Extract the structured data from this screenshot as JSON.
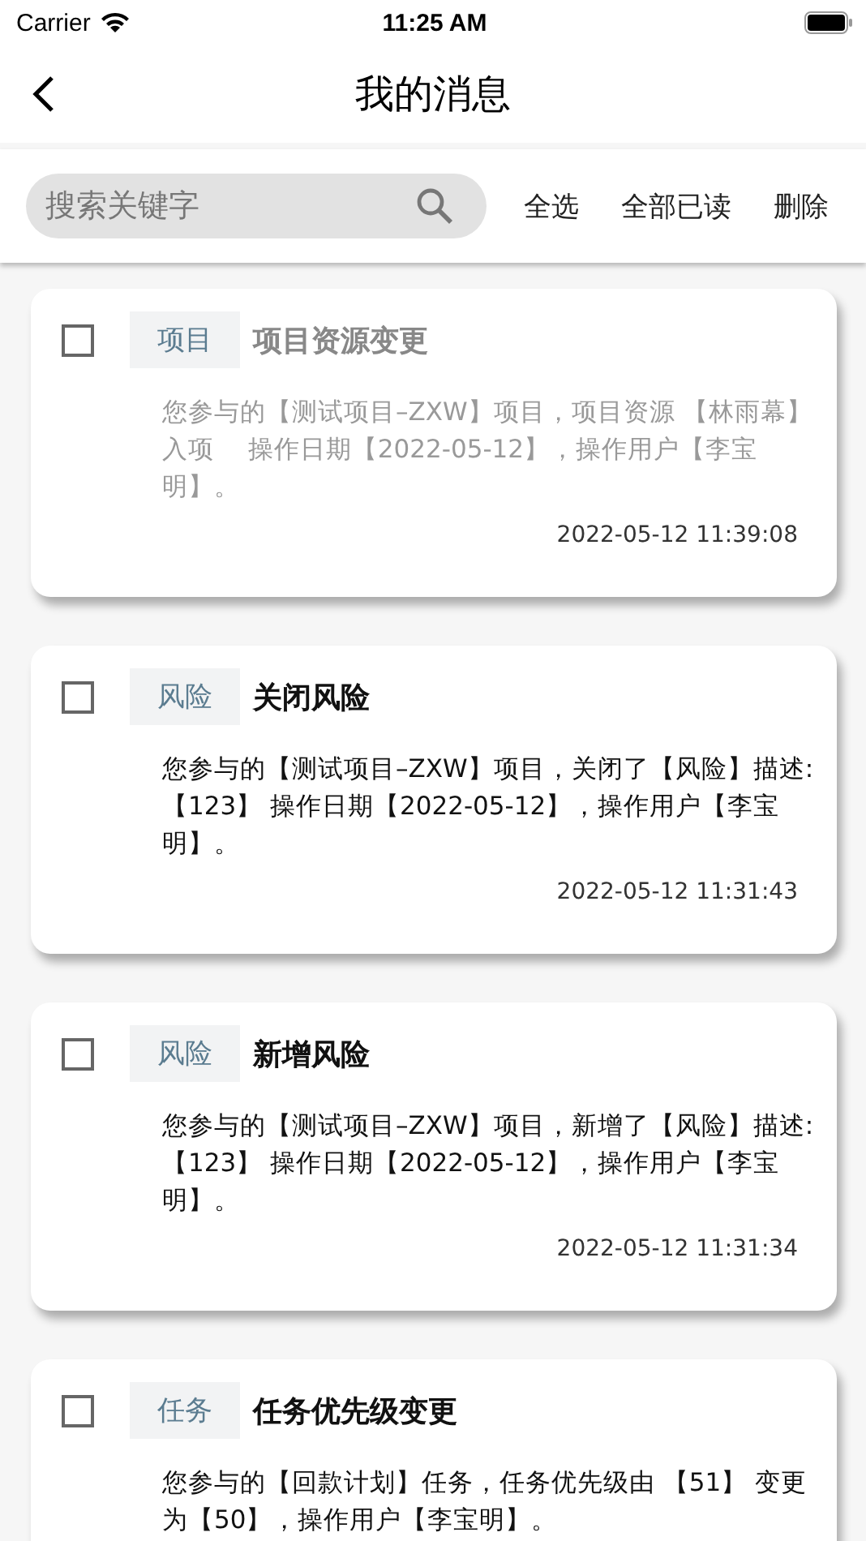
{
  "status_bar": {
    "carrier": "Carrier",
    "time": "11:25 AM"
  },
  "nav": {
    "title": "我的消息"
  },
  "toolbar": {
    "search": {
      "placeholder": "搜索关键字"
    },
    "actions": [
      "全选",
      "全部已读",
      "删除"
    ]
  },
  "messages": [
    {
      "checked": false,
      "read": true,
      "tag": "项目",
      "title": "项目资源变更",
      "body": "您参与的【测试项目–ZXW】项目，项目资源 【林雨幕】入项　 操作日期【2022-05-12】，操作用户【李宝明】。",
      "time": "2022-05-12 11:39:08"
    },
    {
      "checked": false,
      "read": false,
      "tag": "风险",
      "title": "关闭风险",
      "body": "您参与的【测试项目–ZXW】项目，关闭了【风险】描述:【123】 操作日期【2022-05-12】，操作用户【李宝明】。",
      "time": "2022-05-12 11:31:43"
    },
    {
      "checked": false,
      "read": false,
      "tag": "风险",
      "title": "新增风险",
      "body": "您参与的【测试项目–ZXW】项目，新增了【风险】描述:【123】 操作日期【2022-05-12】，操作用户【李宝明】。",
      "time": "2022-05-12 11:31:34"
    },
    {
      "checked": false,
      "read": false,
      "tag": "任务",
      "title": "任务优先级变更",
      "body": "您参与的【回款计划】任务，任务优先级由 【51】 变更为【50】，操作用户【李宝明】。"
    }
  ]
}
